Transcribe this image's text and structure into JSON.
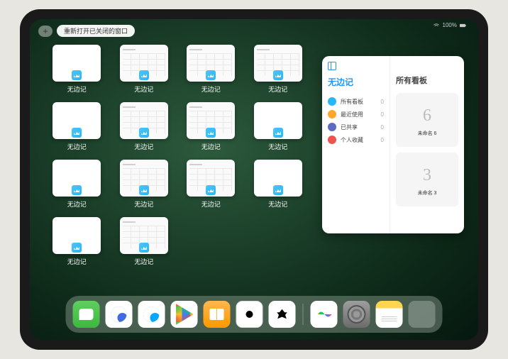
{
  "status": {
    "battery": "100%"
  },
  "top": {
    "add": "+",
    "reopen_label": "重新打开已关闭的窗口"
  },
  "app_name": "无边记",
  "windows": [
    {
      "label": "无边记",
      "style": "blank"
    },
    {
      "label": "无边记",
      "style": "detailed"
    },
    {
      "label": "无边记",
      "style": "detailed"
    },
    {
      "label": "无边记",
      "style": "detailed"
    },
    {
      "label": "无边记",
      "style": "blank"
    },
    {
      "label": "无边记",
      "style": "detailed"
    },
    {
      "label": "无边记",
      "style": "detailed"
    },
    {
      "label": "无边记",
      "style": "blank"
    },
    {
      "label": "无边记",
      "style": "blank"
    },
    {
      "label": "无边记",
      "style": "detailed"
    },
    {
      "label": "无边记",
      "style": "detailed"
    },
    {
      "label": "无边记",
      "style": "blank"
    },
    {
      "label": "无边记",
      "style": "blank"
    },
    {
      "label": "无边记",
      "style": "detailed"
    }
  ],
  "panel": {
    "left_title": "无边记",
    "nav": [
      {
        "label": "所有看板",
        "count": "0",
        "color": "#29b6f6"
      },
      {
        "label": "最近使用",
        "count": "0",
        "color": "#ffa726"
      },
      {
        "label": "已共享",
        "count": "0",
        "color": "#5c6bc0"
      },
      {
        "label": "个人收藏",
        "count": "0",
        "color": "#ef5350"
      }
    ],
    "right_title": "所有看板",
    "boards": [
      {
        "glyph": "6",
        "name": "未命名 6",
        "date": ""
      },
      {
        "glyph": "3",
        "name": "未命名 3",
        "date": ""
      }
    ]
  },
  "dock": {
    "apps": [
      {
        "name": "wechat"
      },
      {
        "name": "qq-hd"
      },
      {
        "name": "qq-browser"
      },
      {
        "name": "play-video"
      },
      {
        "name": "books"
      },
      {
        "name": "dice"
      },
      {
        "name": "himalaya"
      }
    ],
    "recent": [
      {
        "name": "freeform"
      },
      {
        "name": "settings"
      },
      {
        "name": "notes"
      },
      {
        "name": "app-folder"
      }
    ]
  }
}
